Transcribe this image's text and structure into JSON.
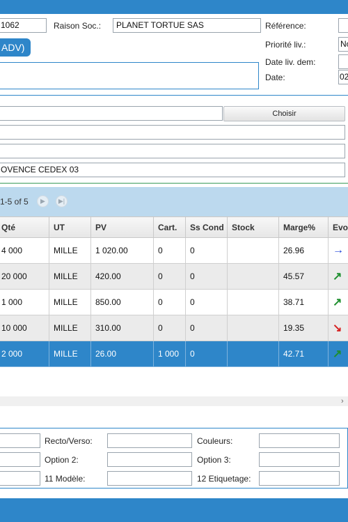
{
  "header": {
    "client_code": "1062",
    "raison_soc_label": "Raison Soc.:",
    "raison_soc_value": "PLANET TORTUE SAS",
    "reference_label": "Référence:",
    "reference_value": "",
    "priorite_label": "Priorité liv.:",
    "priorite_value": "No",
    "date_liv_dem_label": "Date liv. dem:",
    "date_liv_dem_value": "",
    "date_label": "Date:",
    "date_value": "02",
    "tab_label": "ADV)"
  },
  "address": {
    "line1": "",
    "choose_button": "Choisir",
    "line2": "",
    "line3": "",
    "city": "OVENCE CEDEX 03"
  },
  "pager": {
    "range_text": "1-5 of 5"
  },
  "grid": {
    "columns": [
      "Qté",
      "UT",
      "PV",
      "Cart.",
      "Ss Cond",
      "Stock",
      "Marge%",
      "Evo"
    ],
    "rows": [
      {
        "qte": "4 000",
        "ut": "MILLE",
        "pv": "1 020.00",
        "cart": "0",
        "sscond": "0",
        "stock": "",
        "marge": "26.96",
        "evo": "→",
        "evo_color": "#1a3fd6"
      },
      {
        "qte": "20 000",
        "ut": "MILLE",
        "pv": "420.00",
        "cart": "0",
        "sscond": "0",
        "stock": "",
        "marge": "45.57",
        "evo": "↗",
        "evo_color": "#1e8f2e"
      },
      {
        "qte": "1 000",
        "ut": "MILLE",
        "pv": "850.00",
        "cart": "0",
        "sscond": "0",
        "stock": "",
        "marge": "38.71",
        "evo": "↗",
        "evo_color": "#1e8f2e"
      },
      {
        "qte": "10 000",
        "ut": "MILLE",
        "pv": "310.00",
        "cart": "0",
        "sscond": "0",
        "stock": "",
        "marge": "19.35",
        "evo": "↘",
        "evo_color": "#d62020"
      },
      {
        "qte": "2 000",
        "ut": "MILLE",
        "pv": "26.00",
        "cart": "1 000",
        "sscond": "0",
        "stock": "",
        "marge": "42.71",
        "evo": "↗",
        "evo_color": "#1e8f2e"
      }
    ]
  },
  "options": {
    "recto_verso_label": "Recto/Verso:",
    "couleurs_label": "Couleurs:",
    "option2_label": "Option 2:",
    "option3_label": "Option 3:",
    "modele_label": "11 Modèle:",
    "etiquetage_label": "12 Etiquetage:"
  },
  "colors": {
    "accent": "#2e86c9",
    "selected_row": "#2e86c9",
    "pager_bg": "#bcd9ee"
  }
}
